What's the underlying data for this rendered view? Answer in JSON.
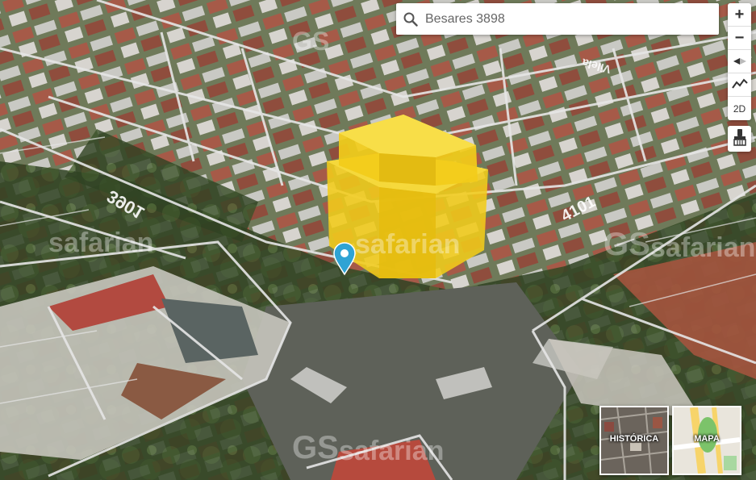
{
  "search": {
    "value": "Besares 3898",
    "icon": "search-icon"
  },
  "zoom": {
    "in_label": "+",
    "out_label": "−"
  },
  "controls": {
    "mode_label": "2D",
    "compass_icon": "compass-icon",
    "tilt_icon": "tilt-icon",
    "paint_icon": "paint-roller-icon"
  },
  "street_labels": {
    "left": "3901",
    "right": "4101",
    "top": "Vilela"
  },
  "watermark": {
    "text": "safarian",
    "logo": "GS"
  },
  "layers": {
    "historic_label": "HISTÓRICA",
    "map_label": "MAPA"
  },
  "colors": {
    "building": "#f2cc1a",
    "marker": "#2fa3d4",
    "lot_lines": "#e6e6e6"
  }
}
